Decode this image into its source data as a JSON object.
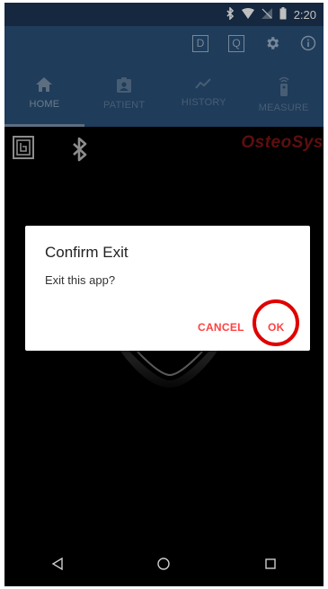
{
  "status_bar": {
    "time": "2:20",
    "icons": [
      "bluetooth-icon",
      "wifi-icon",
      "no-sim-icon",
      "battery-icon"
    ]
  },
  "app_bar": {
    "actions": [
      {
        "name": "d-box-button",
        "letter": "D"
      },
      {
        "name": "q-box-button",
        "letter": "Q"
      },
      {
        "name": "settings-button",
        "icon": "gear-icon"
      },
      {
        "name": "info-button",
        "icon": "info-icon"
      }
    ]
  },
  "tabs": [
    {
      "label": "HOME",
      "icon": "home-icon",
      "active": true
    },
    {
      "label": "PATIENT",
      "icon": "patient-badge-icon",
      "active": false
    },
    {
      "label": "HISTORY",
      "icon": "chart-line-icon",
      "active": false
    },
    {
      "label": "MEASURE",
      "icon": "remote-icon",
      "active": false
    }
  ],
  "content": {
    "brand": "OsteoSys",
    "ble_icon": "ble-icon",
    "bt_icon": "bluetooth-icon"
  },
  "dialog": {
    "title": "Confirm Exit",
    "message": "Exit this app?",
    "cancel_label": "CANCEL",
    "ok_label": "OK"
  },
  "nav": [
    "back-icon",
    "home-circle-icon",
    "recents-icon"
  ],
  "colors": {
    "app_bar": "#2a5078",
    "status_bar": "#1d3654",
    "accent": "#ff4141",
    "highlight": "#e00000"
  }
}
